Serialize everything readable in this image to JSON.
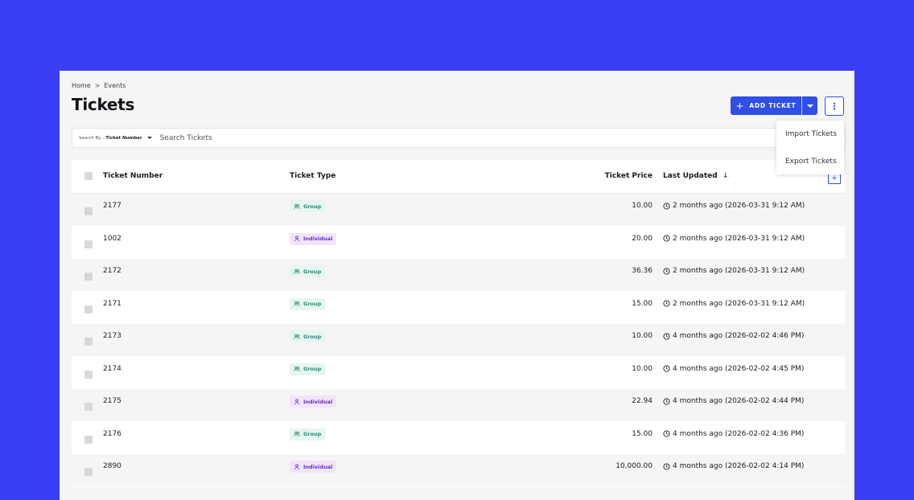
{
  "breadcrumb": {
    "home": "Home",
    "separator": ">",
    "current": "Events"
  },
  "page_title": "Tickets",
  "toolbar": {
    "add_label": "ADD TICKET",
    "add_icon": "plus-icon",
    "more_icon": "more-vertical-icon"
  },
  "menu": {
    "items": [
      "Import Tickets",
      "Export Tickets"
    ]
  },
  "search": {
    "by_label": "Search By :",
    "by_value": "Ticket Number",
    "placeholder": "Search Tickets"
  },
  "table": {
    "headers": {
      "number": "Ticket Number",
      "type": "Ticket Type",
      "price": "Ticket Price",
      "updated": "Last Updated"
    },
    "rows": [
      {
        "number": "2177",
        "type": "Group",
        "price": "10.00",
        "updated": "2 months ago (2026-03-31 9:12 AM)"
      },
      {
        "number": "1002",
        "type": "Individual",
        "price": "20.00",
        "updated": "2 months ago (2026-03-31 9:12 AM)"
      },
      {
        "number": "2172",
        "type": "Group",
        "price": "36.36",
        "updated": "2 months ago (2026-03-31 9:12 AM)"
      },
      {
        "number": "2171",
        "type": "Group",
        "price": "15.00",
        "updated": "2 months ago (2026-03-31 9:12 AM)"
      },
      {
        "number": "2173",
        "type": "Group",
        "price": "10.00",
        "updated": "4 months ago (2026-02-02 4:46 PM)"
      },
      {
        "number": "2174",
        "type": "Group",
        "price": "10.00",
        "updated": "4 months ago (2026-02-02 4:45 PM)"
      },
      {
        "number": "2175",
        "type": "Individual",
        "price": "22.94",
        "updated": "4 months ago (2026-02-02 4:44 PM)"
      },
      {
        "number": "2176",
        "type": "Group",
        "price": "15.00",
        "updated": "4 months ago (2026-02-02 4:36 PM)"
      },
      {
        "number": "2890",
        "type": "Individual",
        "price": "10,000.00",
        "updated": "4 months ago (2026-02-02 4:14 PM)"
      }
    ]
  },
  "colors": {
    "background": "#3a3ef5",
    "accent": "#2f4fe6",
    "group": "#2a8a74",
    "individual": "#6a2dbb"
  }
}
